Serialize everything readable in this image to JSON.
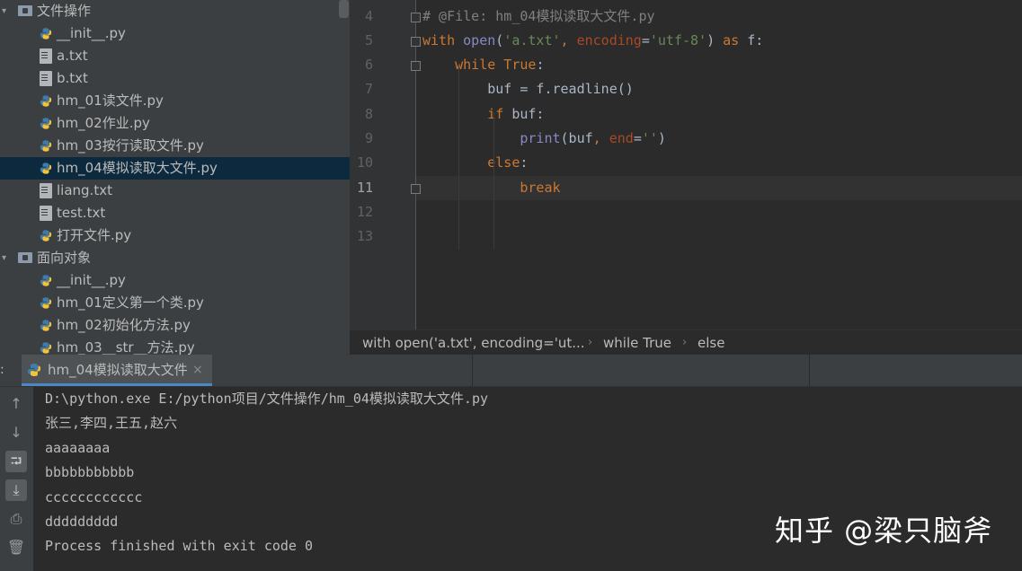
{
  "project_tree": {
    "items": [
      {
        "kind": "folder",
        "label": "文件操作"
      },
      {
        "kind": "py",
        "label": "__init__.py"
      },
      {
        "kind": "txt",
        "label": "a.txt"
      },
      {
        "kind": "txt",
        "label": "b.txt"
      },
      {
        "kind": "py",
        "label": "hm_01读文件.py"
      },
      {
        "kind": "py",
        "label": "hm_02作业.py"
      },
      {
        "kind": "py",
        "label": "hm_03按行读取文件.py"
      },
      {
        "kind": "py",
        "label": "hm_04模拟读取大文件.py",
        "selected": true
      },
      {
        "kind": "txt",
        "label": "liang.txt"
      },
      {
        "kind": "txt",
        "label": "test.txt"
      },
      {
        "kind": "py",
        "label": "打开文件.py"
      },
      {
        "kind": "folder",
        "label": "面向对象"
      },
      {
        "kind": "py",
        "label": "__init__.py"
      },
      {
        "kind": "py",
        "label": "hm_01定义第一个类.py"
      },
      {
        "kind": "py",
        "label": "hm_02初始化方法.py"
      },
      {
        "kind": "py",
        "label": "hm_03__str__方法.py"
      }
    ]
  },
  "editor": {
    "current_line": "11",
    "lines": [
      {
        "num": "4",
        "tokens": [
          [
            "cm",
            "# @File: hm_04模拟读取大文件.py"
          ]
        ]
      },
      {
        "num": "5",
        "tokens": [
          [
            "kw",
            "with "
          ],
          [
            "bi",
            "open"
          ],
          [
            "",
            "("
          ],
          [
            "str",
            "'a.txt'"
          ],
          [
            "kw",
            ", "
          ],
          [
            "prm",
            "encoding"
          ],
          [
            "",
            "="
          ],
          [
            "str",
            "'utf-8'"
          ],
          [
            "",
            ") "
          ],
          [
            "kw",
            "as"
          ],
          [
            "",
            " f:"
          ]
        ]
      },
      {
        "num": "6",
        "tokens": [
          [
            "",
            "    "
          ],
          [
            "kw",
            "while True"
          ],
          [
            "",
            ":"
          ]
        ]
      },
      {
        "num": "7",
        "tokens": [
          [
            "",
            "        buf = f.readline()"
          ]
        ]
      },
      {
        "num": "8",
        "tokens": [
          [
            "",
            "        "
          ],
          [
            "kw",
            "if"
          ],
          [
            "",
            " buf:"
          ]
        ]
      },
      {
        "num": "9",
        "tokens": [
          [
            "",
            "            "
          ],
          [
            "bi",
            "print"
          ],
          [
            "",
            "(buf"
          ],
          [
            "kw",
            ", "
          ],
          [
            "prm",
            "end"
          ],
          [
            "",
            "="
          ],
          [
            "str",
            "''"
          ],
          [
            "",
            ")"
          ]
        ]
      },
      {
        "num": "10",
        "tokens": [
          [
            "",
            "        "
          ],
          [
            "kw",
            "else"
          ],
          [
            "",
            ":"
          ]
        ]
      },
      {
        "num": "11",
        "tokens": [
          [
            "",
            "            "
          ],
          [
            "kw",
            "break"
          ]
        ]
      },
      {
        "num": "12",
        "tokens": []
      },
      {
        "num": "13",
        "tokens": []
      }
    ]
  },
  "breadcrumb": {
    "items": [
      "with open('a.txt', encoding='ut...",
      "while True",
      "else"
    ],
    "separator": "›"
  },
  "run_panel": {
    "prefix": ":",
    "tab_label": "hm_04模拟读取大文件",
    "close_glyph": "×",
    "tools": [
      {
        "name": "up-arrow-icon",
        "glyph": "↑"
      },
      {
        "name": "down-arrow-icon",
        "glyph": "↓"
      },
      {
        "name": "soft-wrap-icon",
        "glyph": "⮒",
        "active": true
      },
      {
        "name": "scroll-to-end-icon",
        "glyph": "⤓",
        "active": true
      },
      {
        "name": "print-icon",
        "glyph": "⎙"
      },
      {
        "name": "trash-icon",
        "glyph": "🗑"
      }
    ],
    "console_lines": [
      "D:\\python.exe E:/python项目/文件操作/hm_04模拟读取大文件.py",
      "张三,李四,王五,赵六",
      "aaaaaaaa",
      "bbbbbbbbbbb",
      "cccccccccccc",
      "ddddddddd",
      "Process finished with exit code 0"
    ]
  },
  "watermark": "知乎 @梁只脑斧",
  "colors": {
    "keyword": "#cc7832",
    "string": "#6a8759",
    "comment": "#808080",
    "builtin": "#8888c6",
    "param": "#aa4926",
    "selection": "#0d293e",
    "tab_underline": "#4a88c7"
  }
}
